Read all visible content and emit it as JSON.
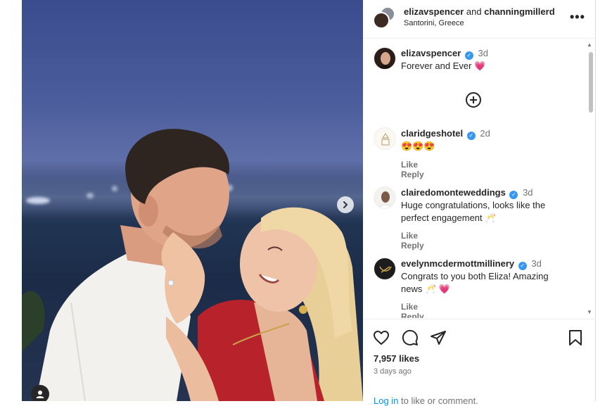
{
  "post": {
    "author": "elizavspencer",
    "connector": "and",
    "coauthor": "channingmillerd",
    "location": "Santorini, Greece",
    "more_glyph": "•••"
  },
  "caption": {
    "user": "elizavspencer",
    "age": "3d",
    "text": "Forever and Ever",
    "emoji": "💗"
  },
  "comments": [
    {
      "user": "claridgeshotel",
      "age": "2d",
      "text": "😍😍😍",
      "like": "Like",
      "reply": "Reply"
    },
    {
      "user": "clairedomonteweddings",
      "age": "3d",
      "text": "Huge congratulations, looks like the perfect engagement",
      "emoji": "🥂",
      "like": "Like",
      "reply": "Reply"
    },
    {
      "user": "evelynmcdermottmillinery",
      "age": "3d",
      "text": "Congrats to you both Eliza! Amazing news",
      "emoji": "🥂 💗",
      "like": "Like",
      "reply": "Reply"
    }
  ],
  "footer": {
    "likes": "7,957 likes",
    "ago": "3 days ago",
    "login_link": "Log in",
    "login_rest": " to like or comment."
  },
  "icons": {
    "like": "heart-icon",
    "comment": "comment-icon",
    "share": "share-icon",
    "save": "bookmark-icon",
    "next": "chevron-right-icon",
    "tag": "user-tag-icon",
    "add": "add-circle-icon"
  },
  "colors": {
    "verified": "#3897f0",
    "link": "#0095f6",
    "muted": "#737373"
  }
}
